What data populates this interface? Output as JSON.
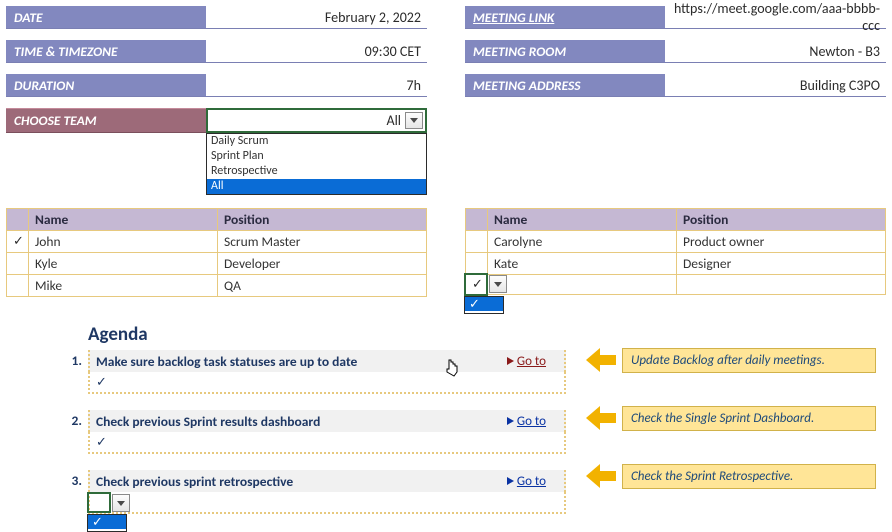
{
  "info": {
    "date_label": "DATE",
    "date_value": "February 2, 2022",
    "time_label": "TIME & TIMEZONE",
    "time_value": "09:30 CET",
    "duration_label": "DURATION",
    "duration_value": "7h",
    "link_label": "MEETING LINK",
    "link_value": "https://meet.google.com/aaa-bbbb-ccc",
    "room_label": "MEETING ROOM",
    "room_value": "Newton - B3",
    "addr_label": "MEETING ADDRESS",
    "addr_value": "Building C3PO"
  },
  "choose": {
    "label": "CHOOSE TEAM",
    "value": "All",
    "options": [
      "Daily Scrum",
      "Sprint Plan",
      "Retrospective",
      "All"
    ],
    "selected_index": 3
  },
  "left_table": {
    "col_name": "Name",
    "col_position": "Position",
    "rows": [
      {
        "check": "✓",
        "name": "John",
        "position": "Scrum Master"
      },
      {
        "check": "",
        "name": "Kyle",
        "position": "Developer"
      },
      {
        "check": "",
        "name": "Mike",
        "position": "QA"
      }
    ]
  },
  "right_table": {
    "col_name": "Name",
    "col_position": "Position",
    "rows": [
      {
        "check": "",
        "name": "Carolyne",
        "position": "Product owner"
      },
      {
        "check": "",
        "name": "Kate",
        "position": "Designer"
      },
      {
        "check": "✓",
        "name": "",
        "position": ""
      }
    ],
    "cell_dropdown": {
      "row": 2,
      "options": [
        "✓",
        ""
      ],
      "selected_index": 0
    }
  },
  "agenda": {
    "title": "Agenda",
    "goto_label": "Go to",
    "items": [
      {
        "num": "1.",
        "text": "Make sure backlog task statuses are up to date",
        "check": "✓",
        "goto_hover": true
      },
      {
        "num": "2.",
        "text": "Check previous Sprint results dashboard",
        "check": "✓",
        "goto_hover": false
      },
      {
        "num": "3.",
        "text": "Check previous sprint retrospective",
        "check": "",
        "goto_hover": false
      }
    ],
    "sub_dropdown": {
      "item": 2,
      "options": [
        "✓",
        ""
      ],
      "selected_index": 0
    }
  },
  "callouts": [
    "Update Backlog after daily meetings.",
    "Check the Single Sprint Dashboard.",
    "Check the Sprint Retrospective."
  ]
}
